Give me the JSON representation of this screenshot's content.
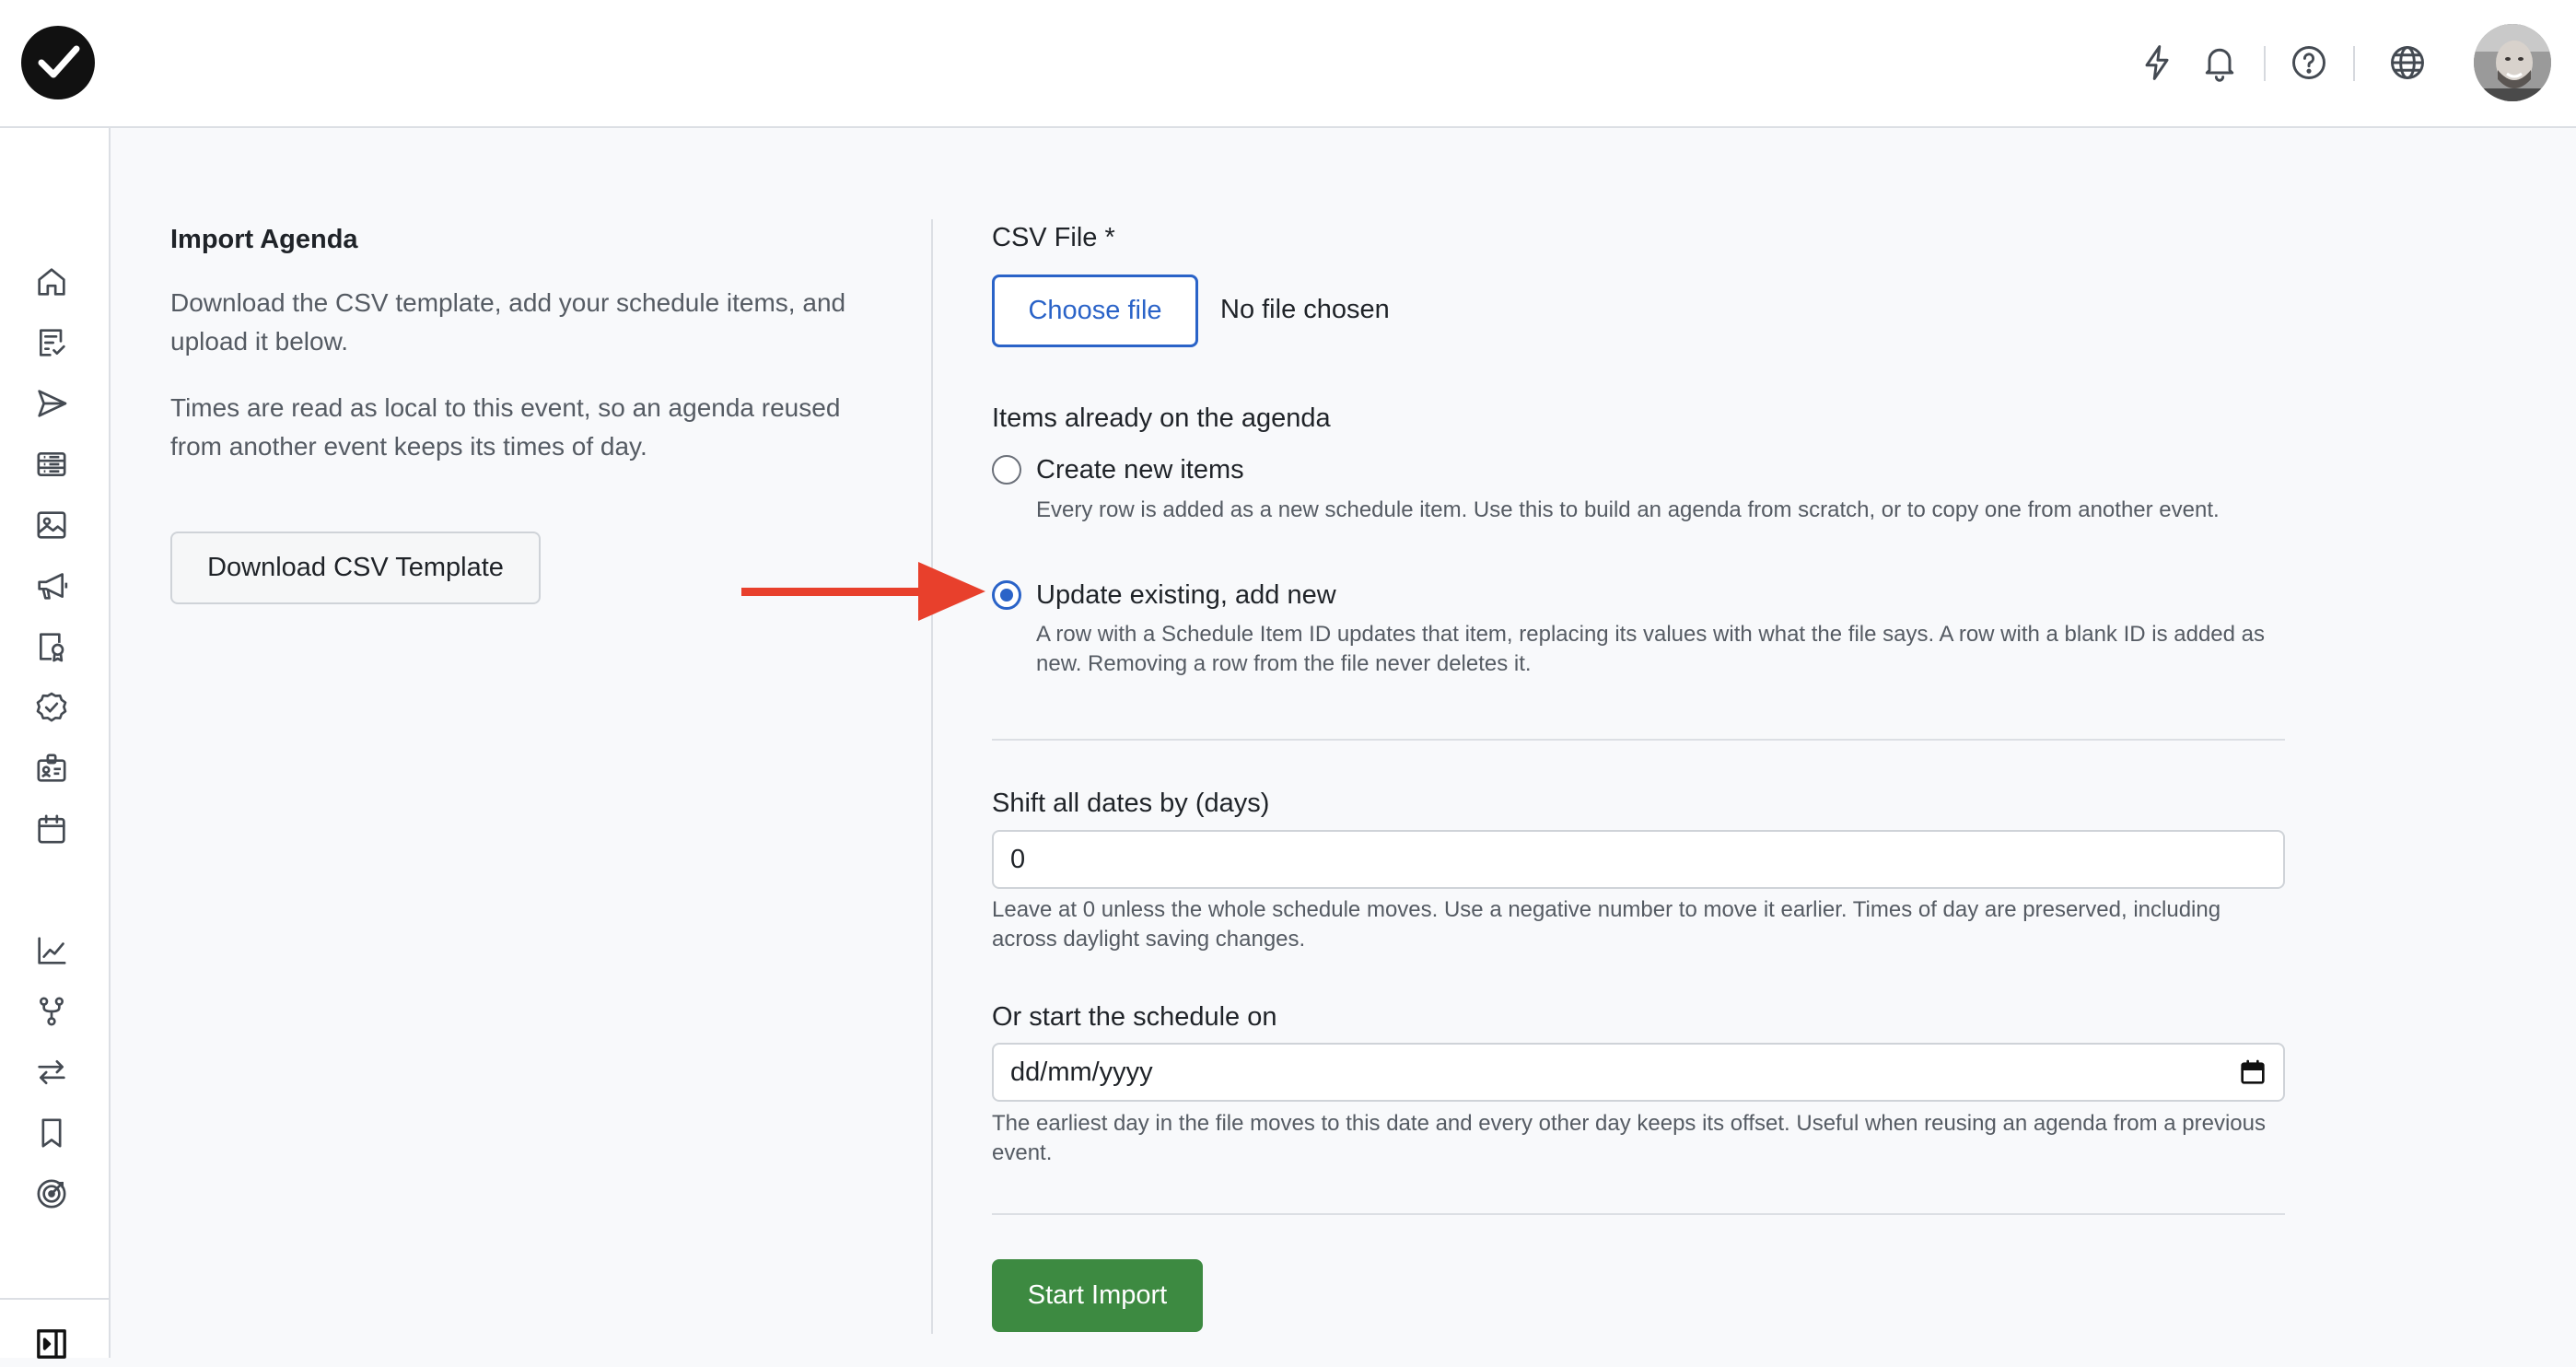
{
  "left": {
    "title": "Import Agenda",
    "paragraph1": "Download the CSV template, add your schedule items, and upload it below.",
    "paragraph2": "Times are read as local to this event, so an agenda reused from another event keeps its times of day.",
    "download_button": "Download CSV Template"
  },
  "form": {
    "csv_label": "CSV File *",
    "choose_file_label": "Choose file",
    "no_file_text": "No file chosen",
    "items_section_label": "Items already on the agenda",
    "options": [
      {
        "label": "Create new items",
        "hint": "Every row is added as a new schedule item. Use this to build an agenda from scratch, or to copy one from another event.",
        "selected": false
      },
      {
        "label": "Update existing, add new",
        "hint": "A row with a Schedule Item ID updates that item, replacing its values with what the file says. A row with a blank ID is added as new. Removing a row from the file never deletes it.",
        "selected": true
      }
    ],
    "shift_label": "Shift all dates by (days)",
    "shift_value": "0",
    "shift_hint": "Leave at 0 unless the whole schedule moves. Use a negative number to move it earlier. Times of day are preserved, including across daylight saving changes.",
    "start_label": "Or start the schedule on",
    "start_placeholder": "dd/mm/yyyy",
    "start_hint": "The earliest day in the file moves to this date and every other day keeps its offset. Useful when reusing an agenda from a previous event.",
    "submit_label": "Start Import"
  },
  "topbar_icons": [
    "lightning-icon",
    "bell-icon",
    "help-icon",
    "globe-icon"
  ],
  "sidebar_icons": [
    "home-icon",
    "checklist-icon",
    "send-icon",
    "list-icon",
    "image-icon",
    "megaphone-icon",
    "badge-icon",
    "check-circle-icon",
    "id-card-icon",
    "calendar-icon",
    "chart-icon",
    "branch-icon",
    "swap-icon",
    "bookmark-icon",
    "target-icon",
    "panel-toggle-icon"
  ],
  "colors": {
    "accent": "#2a63c8",
    "primary_button": "#3d8a41",
    "annotation_arrow": "#e8402c"
  }
}
